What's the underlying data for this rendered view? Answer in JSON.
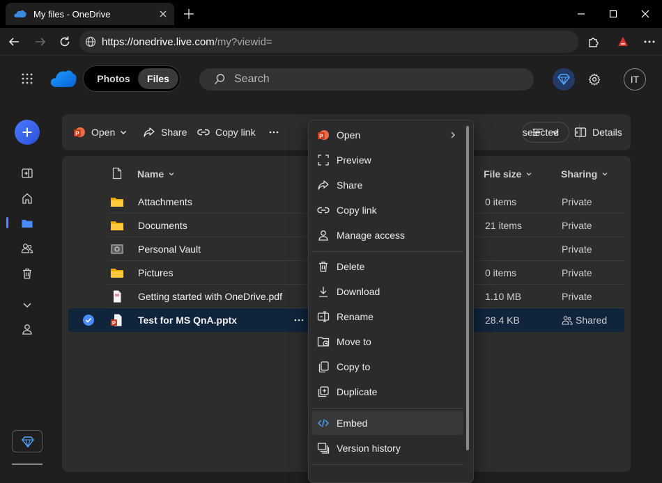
{
  "browser": {
    "tab_title": "My files - OneDrive",
    "url_domain": "https://onedrive.live.com",
    "url_path": "/my?viewid="
  },
  "header": {
    "tab_photos": "Photos",
    "tab_files": "Files",
    "search_placeholder": "Search",
    "avatar_initials": "IT"
  },
  "toolbar": {
    "open_label": "Open",
    "share_label": "Share",
    "copy_link_label": "Copy link",
    "selected_label": "1 selected",
    "details_label": "Details"
  },
  "list": {
    "columns": {
      "name": "Name",
      "file_size": "File size",
      "sharing": "Sharing"
    },
    "rows": [
      {
        "name": "Attachments",
        "icon": "folder-icon",
        "size": "0 items",
        "sharing": "Private"
      },
      {
        "name": "Documents",
        "icon": "folder-icon",
        "size": "21 items",
        "sharing": "Private"
      },
      {
        "name": "Personal Vault",
        "icon": "vault-icon",
        "size": "",
        "sharing": "Private"
      },
      {
        "name": "Pictures",
        "icon": "folder-icon",
        "size": "0 items",
        "sharing": "Private"
      },
      {
        "name": "Getting started with OneDrive.pdf",
        "icon": "pdf-icon",
        "size": "1.10 MB",
        "sharing": "Private"
      },
      {
        "name": "Test for MS QnA.pptx",
        "icon": "pptx-icon",
        "size": "28.4 KB",
        "sharing": "Shared"
      }
    ]
  },
  "context_menu": {
    "items": [
      {
        "label": "Open"
      },
      {
        "label": "Preview"
      },
      {
        "label": "Share"
      },
      {
        "label": "Copy link"
      },
      {
        "label": "Manage access"
      },
      {
        "label": "Delete"
      },
      {
        "label": "Download"
      },
      {
        "label": "Rename"
      },
      {
        "label": "Move to"
      },
      {
        "label": "Copy to"
      },
      {
        "label": "Duplicate"
      },
      {
        "label": "Embed"
      },
      {
        "label": "Version history"
      }
    ]
  },
  "colors": {
    "accent": "#4a8cff",
    "folder": "#ffc83d",
    "powerpoint": "#c43e1c",
    "background": "#1f1f1f",
    "selected_row": "#10243b"
  }
}
